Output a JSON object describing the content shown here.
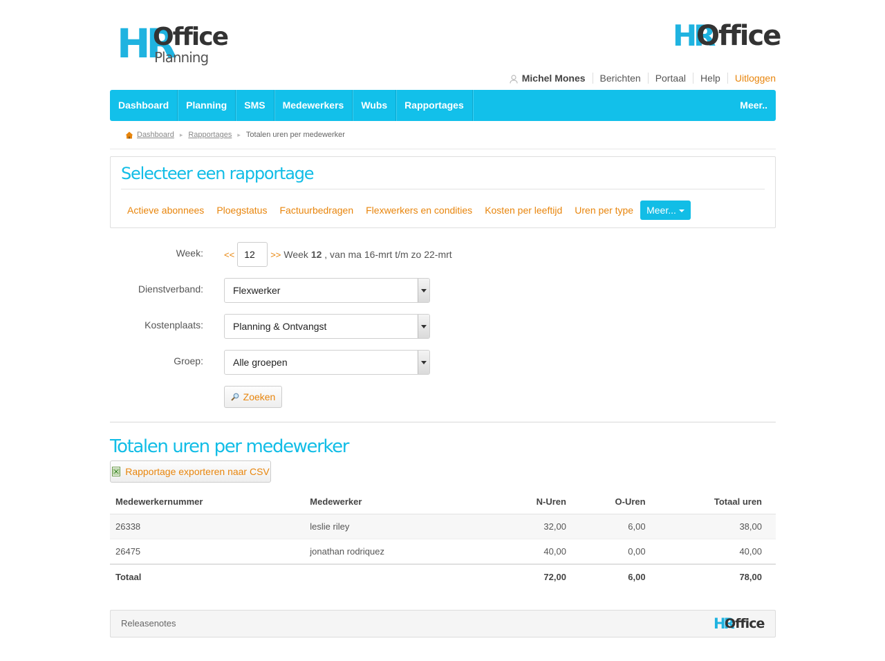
{
  "brand": {
    "main_hr": "HR",
    "main_office": "Office",
    "main_sub": "Planning",
    "right_hr": "HR",
    "right_office": "Office",
    "accent_color": "#12bde6",
    "link_color": "#e8850c"
  },
  "userbar": {
    "user_icon": "user-icon",
    "user_name": "Michel Mones",
    "links": [
      "Berichten",
      "Portaal",
      "Help"
    ],
    "logout": "Uitloggen"
  },
  "nav": {
    "items": [
      "Dashboard",
      "Planning",
      "SMS",
      "Medewerkers",
      "Wubs",
      "Rapportages"
    ],
    "more": "Meer.."
  },
  "breadcrumb": {
    "home_icon": "home-icon",
    "items": [
      "Dashboard",
      "Rapportages"
    ],
    "current": "Totalen uren per medewerker"
  },
  "selector": {
    "title": "Selecteer een rapportage",
    "tabs": [
      "Actieve abonnees",
      "Ploegstatus",
      "Factuurbedragen",
      "Flexwerkers en condities",
      "Kosten per leeftijd",
      "Uren per type"
    ],
    "more": "Meer..."
  },
  "form": {
    "week_label": "Week:",
    "prev": "<<",
    "week_value": "12",
    "next": ">>",
    "week_prefix": "Week",
    "week_number": "12",
    "week_range": ", van ma 16-mrt t/m zo 22-mrt",
    "dienstverband_label": "Dienstverband:",
    "dienstverband_value": "Flexwerker",
    "kostenplaats_label": "Kostenplaats:",
    "kostenplaats_value": "Planning & Ontvangst",
    "groep_label": "Groep:",
    "groep_value": "Alle groepen",
    "search_icon": "magnifier-icon",
    "search_button": "Zoeken"
  },
  "results": {
    "title": "Totalen uren per medewerker",
    "export_icon": "spreadsheet-icon",
    "export_button": "Rapportage exporteren naar CSV",
    "columns": [
      "Medewerkernummer",
      "Medewerker",
      "N-Uren",
      "O-Uren",
      "Totaal uren"
    ],
    "rows": [
      {
        "nummer": "26338",
        "naam": "leslie riley",
        "n": "32,00",
        "o": "6,00",
        "totaal": "38,00"
      },
      {
        "nummer": "26475",
        "naam": "jonathan rodriquez",
        "n": "40,00",
        "o": "0,00",
        "totaal": "40,00"
      }
    ],
    "total": {
      "label": "Totaal",
      "n": "72,00",
      "o": "6,00",
      "totaal": "78,00"
    }
  },
  "footer": {
    "releasenotes": "Releasenotes",
    "logo_hr": "HR",
    "logo_office": "Office"
  }
}
